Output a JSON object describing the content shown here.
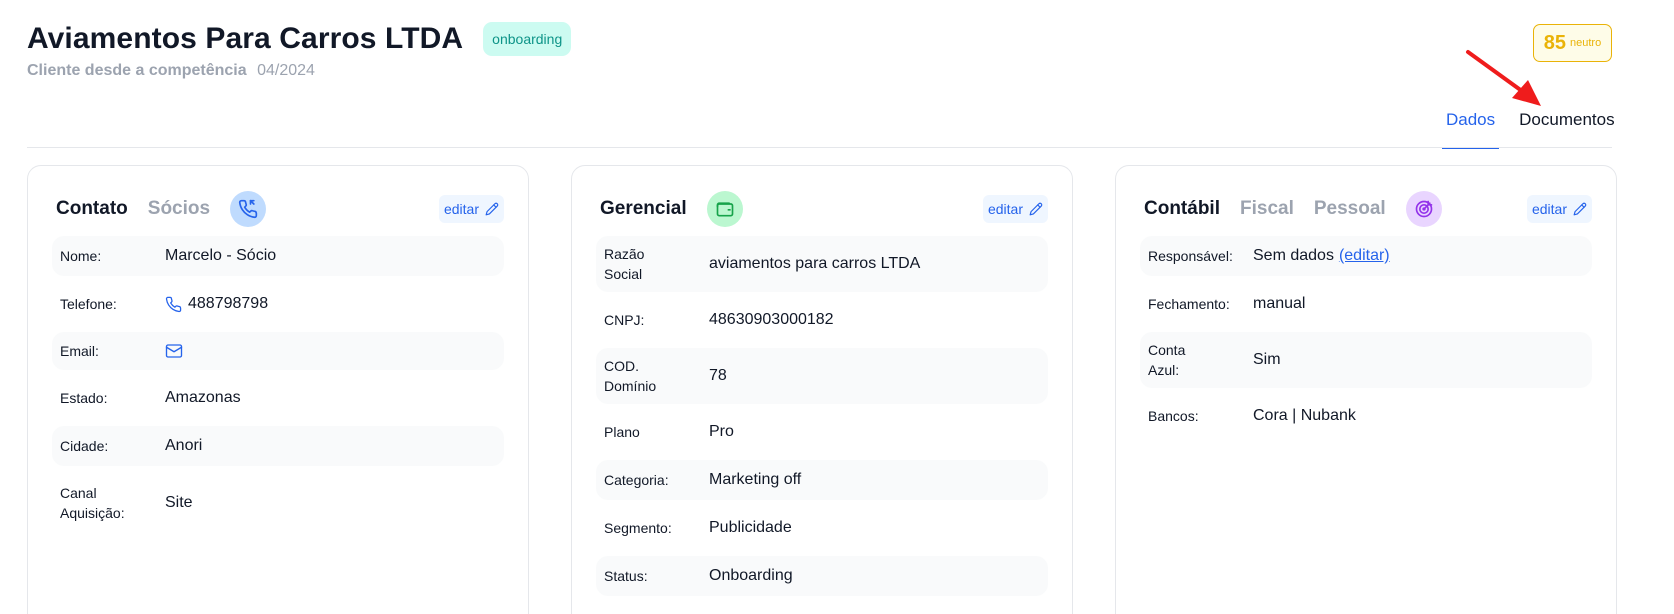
{
  "header": {
    "title": "Aviamentos Para Carros LTDA",
    "status": "onboarding",
    "subtitle_label": "Cliente desde a competência",
    "subtitle_value": "04/2024"
  },
  "score": {
    "value": "85",
    "label": "neutro"
  },
  "tabs": [
    {
      "label": "Dados",
      "active": true
    },
    {
      "label": "Documentos",
      "active": false
    }
  ],
  "contato_card": {
    "tabs": [
      "Contato",
      "Sócios"
    ],
    "edit_label": "editar",
    "icon": "phone-icon",
    "rows": [
      {
        "label": "Nome:",
        "value": "Marcelo - Sócio"
      },
      {
        "label": "Telefone:",
        "value": "488798798"
      },
      {
        "label": "Email:",
        "value": ""
      },
      {
        "label": "Estado:",
        "value": "Amazonas"
      },
      {
        "label": "Cidade:",
        "value": "Anori"
      },
      {
        "label": "Canal Aquisição:",
        "value": "Site"
      }
    ]
  },
  "gerencial_card": {
    "tabs": [
      "Gerencial"
    ],
    "edit_label": "editar",
    "icon": "wallet-icon",
    "rows": [
      {
        "label": "Razão Social",
        "value": "aviamentos para carros LTDA"
      },
      {
        "label": "CNPJ:",
        "value": "48630903000182"
      },
      {
        "label": "COD. Domínio",
        "value": "78"
      },
      {
        "label": "Plano",
        "value": "Pro"
      },
      {
        "label": "Categoria:",
        "value": "Marketing off"
      },
      {
        "label": "Segmento:",
        "value": "Publicidade"
      },
      {
        "label": "Status:",
        "value": "Onboarding"
      }
    ]
  },
  "contabil_card": {
    "tabs": [
      "Contábil",
      "Fiscal",
      "Pessoal"
    ],
    "edit_label": "editar",
    "icon": "target-icon",
    "rows": [
      {
        "label": "Responsável:",
        "value": "Sem dados",
        "link": "(editar)"
      },
      {
        "label": "Fechamento:",
        "value": "manual"
      },
      {
        "label": "Conta Azul:",
        "value": "Sim"
      },
      {
        "label": "Bancos:",
        "value": "Cora | Nubank"
      }
    ]
  },
  "colors": {
    "accent": "#2563eb",
    "score": "#eab308",
    "status_bg": "#ccfbf1",
    "status_text": "#0d9488",
    "arrow": "#ef1c1c"
  }
}
